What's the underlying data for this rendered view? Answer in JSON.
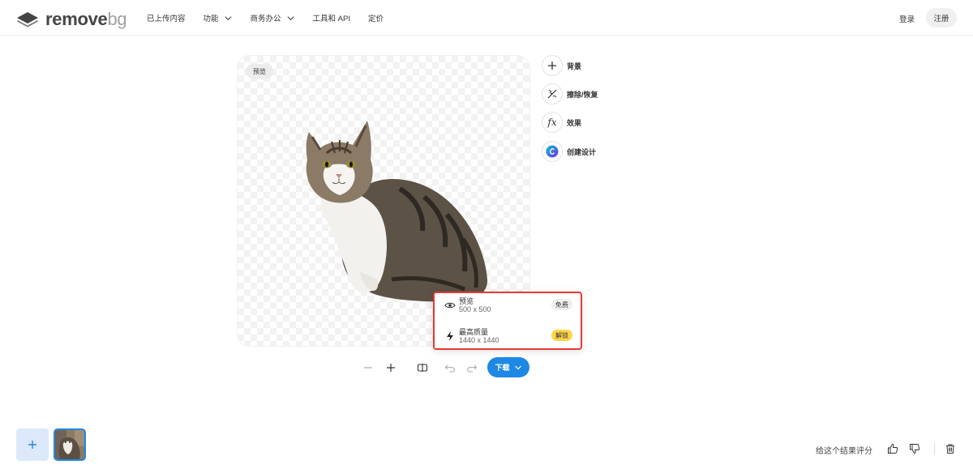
{
  "header": {
    "logo_main": "remove",
    "logo_bg": "bg",
    "nav": [
      {
        "label": "已上传内容"
      },
      {
        "label": "功能"
      },
      {
        "label": "商务办公"
      },
      {
        "label": "工具和 API"
      },
      {
        "label": "定价"
      }
    ],
    "login": "登录",
    "signup": "注册"
  },
  "preview": {
    "badge": "预览"
  },
  "tools": [
    {
      "label": "背景",
      "icon": "plus-icon"
    },
    {
      "label": "擦除/恢复",
      "icon": "brush-icon"
    },
    {
      "label": "效果",
      "icon": "fx-icon"
    },
    {
      "label": "创建设计",
      "icon": "canva-icon"
    }
  ],
  "download_menu": {
    "options": [
      {
        "title": "预览",
        "size": "500 x 500",
        "tag": "免费",
        "icon": "eye-icon"
      },
      {
        "title": "最高质量",
        "size": "1440 x 1440",
        "tag": "解锁",
        "icon": "bolt-icon"
      }
    ]
  },
  "toolbar": {
    "download_label": "下载"
  },
  "rating": {
    "text": "给这个结果评分"
  },
  "colors": {
    "accent": "#1e88e5",
    "highlight": "#e53935",
    "unlock": "#ffd54a"
  }
}
